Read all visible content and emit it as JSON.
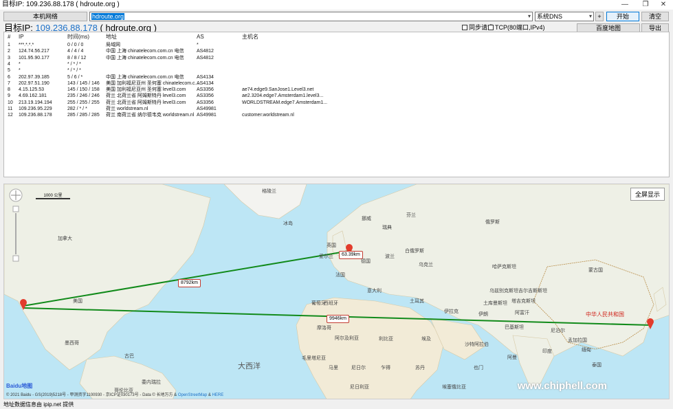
{
  "window": {
    "title": "目标IP: 109.236.88.178 ( hdroute.org )",
    "controls": [
      "—",
      "❐",
      "✕"
    ]
  },
  "toolbar": {
    "local_network_btn": "本机网络",
    "host_value": "hdroute.org",
    "dns_select": "系统DNS",
    "plus_btn": "+",
    "start_btn": "开始",
    "clear_btn": "清空"
  },
  "target": {
    "prefix": "目标IP:",
    "ip": "109.236.88.178",
    "host": "( hdroute.org )"
  },
  "options": {
    "sync_request": "同步请求",
    "tcp_mode": "TCP(80端口,IPv4)",
    "baidu_map_btn": "百度地图",
    "export_btn": "导出"
  },
  "table": {
    "headers": [
      "#",
      "IP",
      "时间(ms)",
      "地址",
      "AS",
      "主机名"
    ],
    "rows": [
      [
        "1",
        "***.*.*.*",
        "0 / 0 / 0",
        "局域网",
        "*",
        ""
      ],
      [
        "2",
        "124.74.56.217",
        "4 / 4 / 4",
        "中国 上海 chinatelecom.com.cn 电信",
        "AS4812",
        ""
      ],
      [
        "3",
        "101.95.90.177",
        "8 / 8 / 12",
        "中国 上海 chinatelecom.com.cn 电信",
        "AS4812",
        ""
      ],
      [
        "4",
        "*",
        "* / * / *",
        "",
        "",
        ""
      ],
      [
        "5",
        "*",
        "* / * / *",
        "",
        "",
        ""
      ],
      [
        "6",
        "202.97.39.185",
        "5 / 6 / *",
        "中国 上海 chinatelecom.com.cn 电信",
        "AS4134",
        ""
      ],
      [
        "7",
        "202.97.51.190",
        "143 / 145 / 146",
        "美国 加利福尼亚州 圣何塞 chinatelecom.c...",
        "AS4134",
        ""
      ],
      [
        "8",
        "4.15.125.53",
        "145 / 150 / 158",
        "美国 加利福尼亚州 圣何塞 level3.com",
        "AS3356",
        "ae74.edge9.SanJose1.Level3.net"
      ],
      [
        "9",
        "4.69.162.181",
        "235 / 246 / 246",
        "荷兰 北荷兰省 阿姆斯特丹 level3.com",
        "AS3356",
        "ae2.3204.edge7.Amsterdam1.level3..."
      ],
      [
        "10",
        "213.19.194.194",
        "255 / 255 / 255",
        "荷兰 北荷兰省 阿姆斯特丹 level3.com",
        "AS3356",
        "WORLDSTREAM.edge7.Amsterdam1..."
      ],
      [
        "11",
        "109.236.95.229",
        "282 / * / *",
        "荷兰 worldstream.nl",
        "AS49981",
        ""
      ],
      [
        "12",
        "109.236.88.178",
        "285 / 285 / 285",
        "荷兰 南荷兰省 纳尔德韦克 worldstream.nl",
        "AS49981",
        "customer.worldstream.nl"
      ]
    ]
  },
  "map": {
    "fullscreen_btn": "全屏显示",
    "scale_label": "1000 公里",
    "distances": [
      "8792km",
      "63.39km",
      "9946km"
    ],
    "labels": {
      "canada": "加拿大",
      "usa": "美国",
      "atlantic": "大西洋",
      "mexico": "墨西哥",
      "china": "中华人民共和国",
      "uk": "英国",
      "france": "法国",
      "germany": "德国",
      "spain": "西班牙",
      "italy": "意大利",
      "libya": "利比亚",
      "egypt": "埃及",
      "algeria": "阿尔及利亚",
      "saudi": "沙特阿拉伯",
      "iran": "伊朗",
      "kazakhstan": "哈萨克斯坦",
      "mongolia": "蒙古国",
      "mali": "马里",
      "niger": "尼日尔",
      "chad": "乍得",
      "sudan": "苏丹",
      "turkey": "土耳其",
      "ukraine": "乌克兰",
      "russia": "俄罗斯",
      "norway": "挪威",
      "sweden": "瑞典",
      "finland": "芬兰",
      "poland": "波兰",
      "belarus": "白俄罗斯",
      "iraq": "伊拉克",
      "afghanistan": "阿富汗",
      "pakistan": "巴基斯坦",
      "india": "印度",
      "morocco": "摩洛哥",
      "cuba": "古巴",
      "venezuela": "委内瑞拉",
      "colombia": "哥伦比亚",
      "greenland": "格陵兰",
      "iceland": "冰岛",
      "ireland": "爱尔兰",
      "portugal": "葡萄牙",
      "mauritania": "毛里塔尼亚",
      "nigeria": "尼日利亚",
      "ethiopia": "埃塞俄比亚",
      "yemen": "也门",
      "oman": "阿曼",
      "tajik": "塔吉克斯坦",
      "kyrgyz": "吉尔吉斯斯坦",
      "uzbek": "乌兹别克斯坦",
      "turkmen": "土库曼斯坦",
      "myanmar": "缅甸",
      "thailand": "泰国",
      "nepal": "尼泊尔",
      "bangladesh": "孟加拉国"
    },
    "baidu_logo": "Baidu地图",
    "copyright_text": "© 2021 Baidu - GS(2019)5218号 - 甲测资字1100930 - 京ICP证030173号 - Data © 长地万方 &",
    "osm_link": "OpenStreetMap",
    "amp": "&",
    "here_link": "HERE",
    "watermark": "www.chiphell.com"
  },
  "status": {
    "text": "地址数据信息由 ipip.net 提供"
  }
}
